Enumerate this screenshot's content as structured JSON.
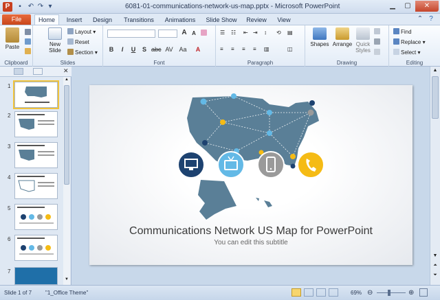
{
  "window": {
    "title": "6081-01-communications-network-us-map.pptx - Microsoft PowerPoint",
    "app_icon": "P"
  },
  "ribbon_tabs": [
    {
      "label": "File"
    },
    {
      "label": "Home"
    },
    {
      "label": "Insert"
    },
    {
      "label": "Design"
    },
    {
      "label": "Transitions"
    },
    {
      "label": "Animations"
    },
    {
      "label": "Slide Show"
    },
    {
      "label": "Review"
    },
    {
      "label": "View"
    }
  ],
  "ribbon": {
    "clipboard": {
      "label": "Clipboard",
      "paste": "Paste"
    },
    "slides": {
      "label": "Slides",
      "new_slide_line1": "New",
      "new_slide_line2": "Slide",
      "layout": "Layout",
      "reset": "Reset",
      "section": "Section"
    },
    "font": {
      "label": "Font",
      "bold": "B",
      "italic": "I",
      "underline": "U",
      "strike": "S",
      "spacing": "AV",
      "case": "Aa",
      "grow": "A",
      "shrink": "A"
    },
    "paragraph": {
      "label": "Paragraph"
    },
    "drawing": {
      "label": "Drawing",
      "shapes": "Shapes",
      "arrange": "Arrange",
      "quick_styles_1": "Quick",
      "quick_styles_2": "Styles"
    },
    "editing": {
      "label": "Editing",
      "find": "Find",
      "replace": "Replace",
      "select": "Select"
    }
  },
  "thumbnails": [
    {
      "num": "1"
    },
    {
      "num": "2"
    },
    {
      "num": "3"
    },
    {
      "num": "4"
    },
    {
      "num": "5"
    },
    {
      "num": "6"
    },
    {
      "num": "7"
    }
  ],
  "slide": {
    "title": "Communications Network US Map for PowerPoint",
    "subtitle": "You can edit this subtitle"
  },
  "status": {
    "slide_of": "Slide 1 of 7",
    "theme": "\"1_Office Theme\"",
    "zoom": "69%"
  },
  "colors": {
    "map": "#5a7f97",
    "navy": "#1d4270",
    "lightblue": "#63b9e6",
    "gray": "#9a9a9a",
    "yellow": "#f5bb15"
  }
}
